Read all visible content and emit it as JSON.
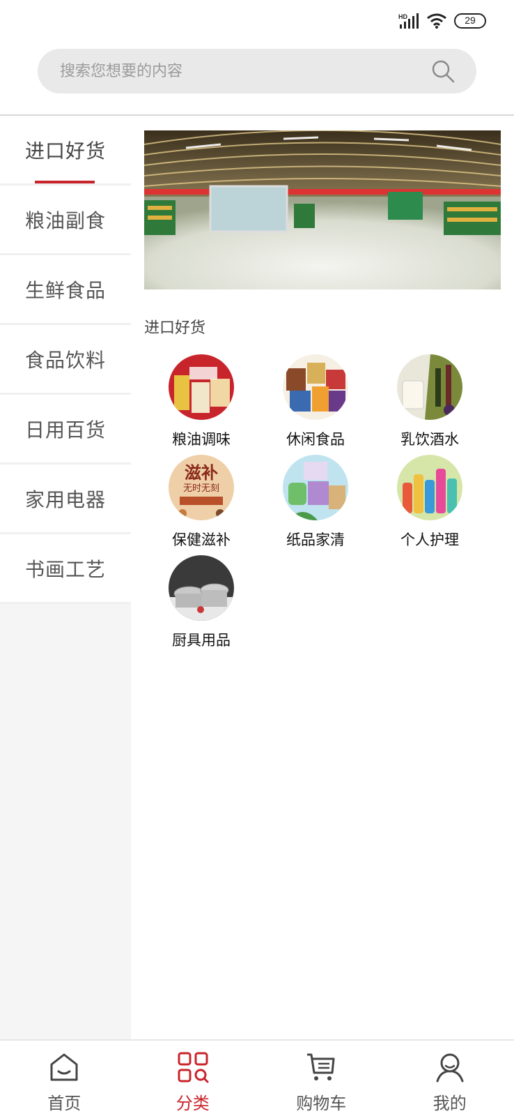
{
  "status_bar": {
    "network": "HD",
    "battery": "29"
  },
  "search": {
    "placeholder": "搜索您想要的内容"
  },
  "sidebar": {
    "items": [
      {
        "label": "进口好货",
        "active": true
      },
      {
        "label": "粮油副食",
        "active": false
      },
      {
        "label": "生鲜食品",
        "active": false
      },
      {
        "label": "食品饮料",
        "active": false
      },
      {
        "label": "日用百货",
        "active": false
      },
      {
        "label": "家用电器",
        "active": false
      },
      {
        "label": "书画工艺",
        "active": false
      }
    ]
  },
  "content": {
    "section_title": "进口好货",
    "categories": [
      {
        "label": "粮油调味"
      },
      {
        "label": "休闲食品"
      },
      {
        "label": "乳饮酒水"
      },
      {
        "label": "保健滋补",
        "image_text": [
          "滋补",
          "无时无刻"
        ]
      },
      {
        "label": "纸品家清"
      },
      {
        "label": "个人护理"
      },
      {
        "label": "厨具用品"
      }
    ]
  },
  "bottom_nav": {
    "items": [
      {
        "label": "首页",
        "icon": "home-icon",
        "active": false
      },
      {
        "label": "分类",
        "icon": "category-icon",
        "active": true
      },
      {
        "label": "购物车",
        "icon": "cart-icon",
        "active": false
      },
      {
        "label": "我的",
        "icon": "user-icon",
        "active": false
      }
    ]
  },
  "colors": {
    "accent": "#c8242b",
    "sidebar_bg": "#f5f5f5",
    "search_bg": "#e9e9e9"
  }
}
